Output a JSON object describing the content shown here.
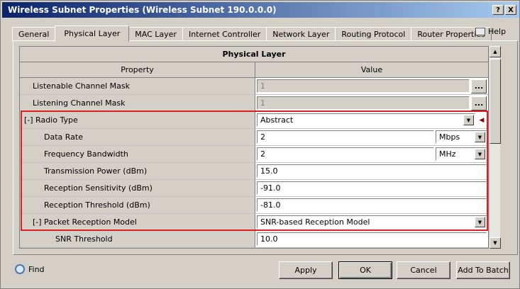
{
  "window": {
    "title": "Wireless Subnet Properties (Wireless Subnet 190.0.0.0)",
    "help_btn": "?",
    "close_btn": "X"
  },
  "tabs": [
    "General",
    "Physical Layer",
    "MAC Layer",
    "Internet Controller",
    "Network Layer",
    "Routing Protocol",
    "Router Properties"
  ],
  "help_label": "Help",
  "grid": {
    "section_title": "Physical Layer",
    "col_property": "Property",
    "col_value": "Value",
    "rows": [
      {
        "label": "Listenable Channel Mask",
        "value": "1"
      },
      {
        "label": "Listening Channel Mask",
        "value": "1"
      },
      {
        "label": "[-] Radio Type",
        "value": "Abstract"
      },
      {
        "label": "Data Rate",
        "value": "2",
        "unit": "Mbps"
      },
      {
        "label": "Frequency Bandwidth",
        "value": "2",
        "unit": "MHz"
      },
      {
        "label": "Transmission Power (dBm)",
        "value": "15.0"
      },
      {
        "label": "Reception Sensitivity (dBm)",
        "value": "-91.0"
      },
      {
        "label": "Reception Threshold (dBm)",
        "value": "-81.0"
      },
      {
        "label": "[-] Packet Reception Model",
        "value": "SNR-based Reception Model"
      },
      {
        "label": "SNR Threshold",
        "value": "10.0"
      }
    ],
    "ellipsis": "..."
  },
  "footer": {
    "find": "Find",
    "apply": "Apply",
    "ok": "OK",
    "cancel": "Cancel",
    "add_to_batch": "Add To Batch"
  },
  "colors": {
    "highlight": "#e02020",
    "titlebar": "#0a246a"
  }
}
